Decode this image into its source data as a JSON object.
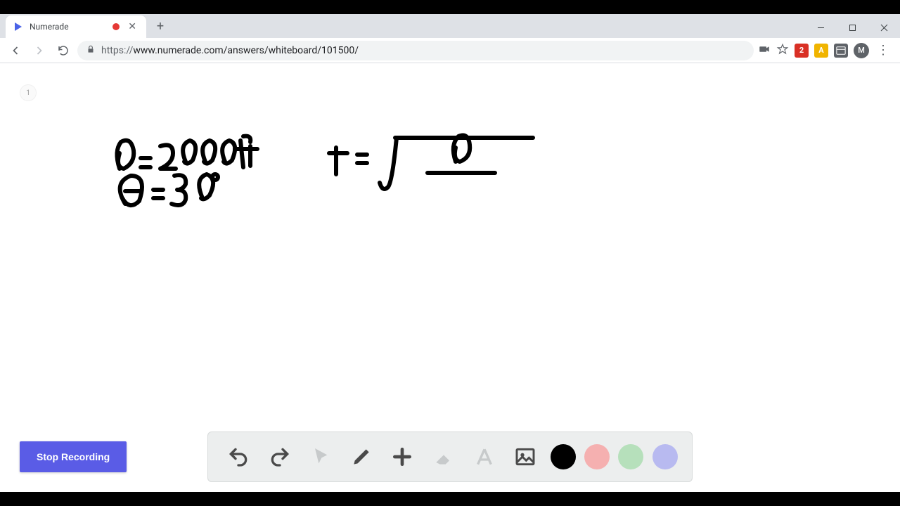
{
  "tab": {
    "title": "Numerade"
  },
  "address": {
    "protocol": "https://",
    "url": "www.numerade.com/answers/whiteboard/101500/"
  },
  "profile": {
    "initial": "M"
  },
  "whiteboard": {
    "page_indicator": "1",
    "stop_button_label": "Stop Recording",
    "handwriting": {
      "line1": "d = 2000ft",
      "line2": "θ = 30°",
      "equation": "t = √(d / )"
    }
  },
  "toolbar": {
    "colors": {
      "black": "#000000",
      "red": "#f5b0b0",
      "green": "#b6e0bb",
      "purple": "#b8baf0"
    }
  },
  "extensions": {
    "ext1": {
      "label": "2",
      "bg": "#d93025",
      "fg": "#ffffff"
    },
    "ext2": {
      "label": "A",
      "bg": "#f0b400",
      "fg": "#ffffff"
    },
    "ext3": {
      "label": "",
      "bg": "#5f6368",
      "fg": "#ffffff"
    }
  }
}
